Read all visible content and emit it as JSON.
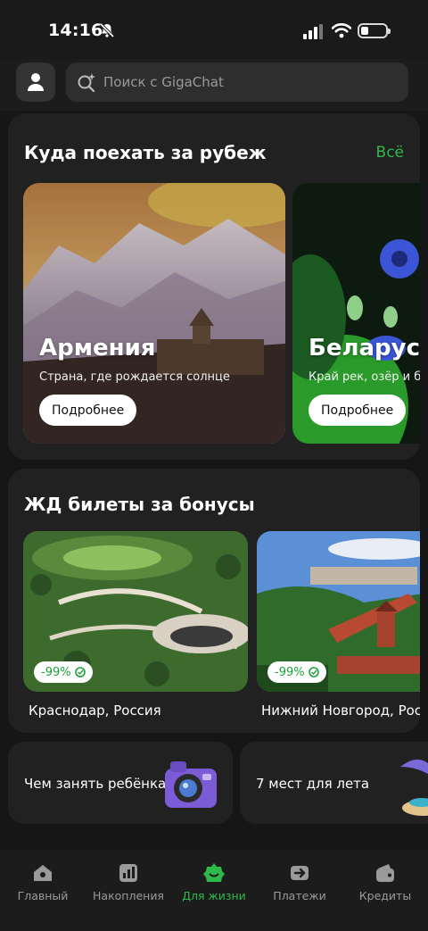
{
  "status": {
    "time": "14:16"
  },
  "search": {
    "placeholder": "Поиск с GigaChat"
  },
  "abroad": {
    "title": "Куда поехать за рубеж",
    "all_label": "Всё",
    "items": [
      {
        "name": "Армения",
        "desc": "Страна, где рождается солнце",
        "button": "Подробнее"
      },
      {
        "name": "Беларусь",
        "desc": "Край рек, озёр и бе",
        "button": "Подробнее"
      }
    ]
  },
  "rail": {
    "title": "ЖД билеты за бонусы",
    "items": [
      {
        "discount": "-99%",
        "city": "Краснодар, Россия"
      },
      {
        "discount": "-99%",
        "city": "Нижний Новгород, Росси"
      }
    ]
  },
  "mini_cards": [
    {
      "label": "Чем занять ребёнка"
    },
    {
      "label": "7 мест для лета"
    }
  ],
  "tabbar": {
    "items": [
      {
        "label": "Главный",
        "icon": "home-icon"
      },
      {
        "label": "Накопления",
        "icon": "chart-icon"
      },
      {
        "label": "Для жизни",
        "icon": "star-icon",
        "active": true
      },
      {
        "label": "Платежи",
        "icon": "arrow-icon"
      },
      {
        "label": "Кредиты",
        "icon": "wallet-icon"
      }
    ]
  },
  "colors": {
    "accent": "#2fb84b",
    "background": "#161616",
    "card": "#212121"
  }
}
